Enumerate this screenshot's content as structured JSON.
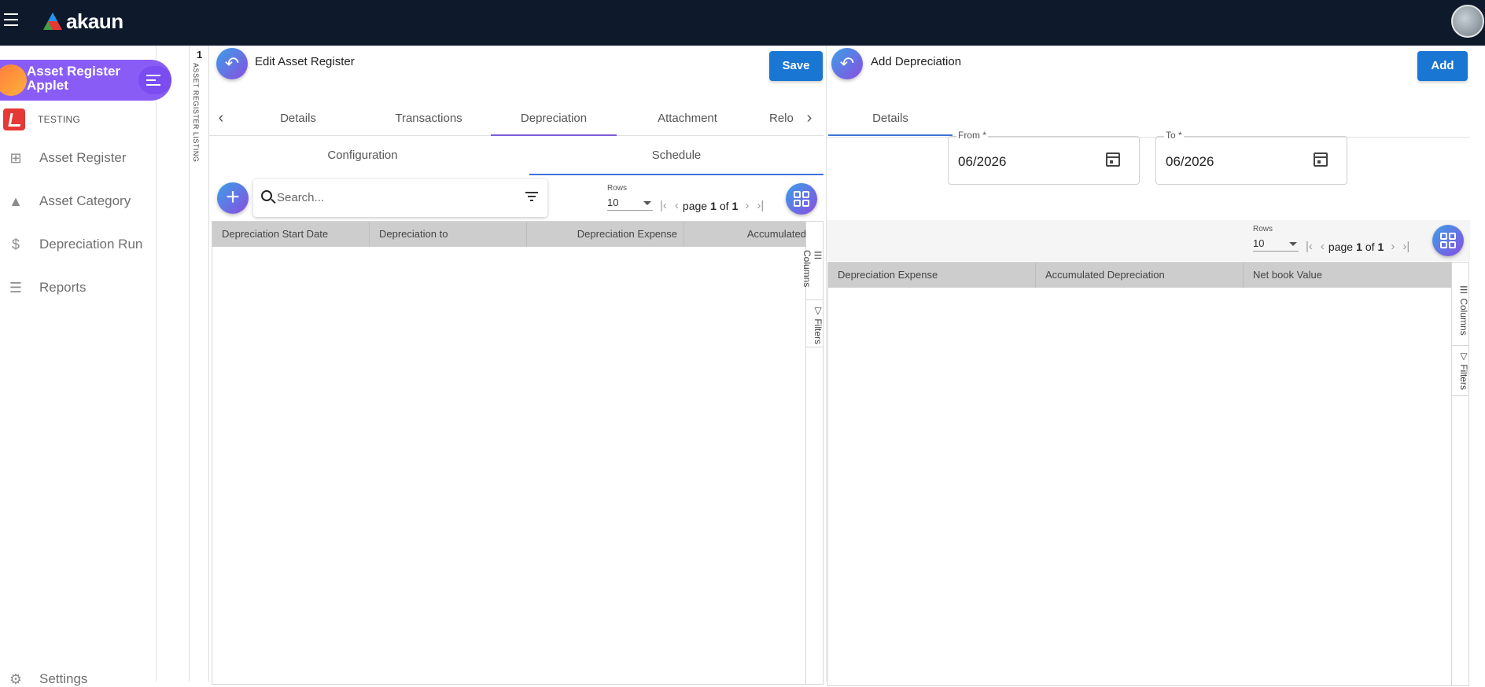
{
  "topbar": {
    "brand": "akaun"
  },
  "sidebar": {
    "applet_title": "Asset Register Applet",
    "org_label": "TESTING",
    "items": [
      {
        "label": "Asset Register",
        "icon": "chart-add-icon"
      },
      {
        "label": "Asset Category",
        "icon": "shapes-icon"
      },
      {
        "label": "Depreciation Run",
        "icon": "dollar-icon"
      },
      {
        "label": "Reports",
        "icon": "list-icon"
      },
      {
        "label": "Settings",
        "icon": "gear-icon"
      }
    ]
  },
  "listing": {
    "count": "1",
    "label": "ASSET REGISTER LISTING"
  },
  "edit_panel": {
    "title": "Edit Asset Register",
    "save_label": "Save",
    "tabs": [
      "Details",
      "Transactions",
      "Depreciation",
      "Attachment",
      "Relo"
    ],
    "subtabs": [
      "Configuration",
      "Schedule"
    ],
    "search_placeholder": "Search...",
    "rows_label": "Rows",
    "rows_value": "10",
    "pager": {
      "page_word": "page",
      "page": "1",
      "of_word": "of",
      "total": "1"
    },
    "columns": [
      "Depreciation Start Date",
      "Depreciation to",
      "Depreciation Expense",
      "Accumulated"
    ],
    "side_tools": [
      "Columns",
      "Filters"
    ]
  },
  "add_panel": {
    "title": "Add Depreciation",
    "add_label": "Add",
    "tab": "Details",
    "from_label": "From *",
    "from_value": "06/2026",
    "to_label": "To *",
    "to_value": "06/2026",
    "rows_label": "Rows",
    "rows_value": "10",
    "pager": {
      "page_word": "page",
      "page": "1",
      "of_word": "of",
      "total": "1"
    },
    "columns": [
      "Depreciation Expense",
      "Accumulated Depreciation",
      "Net book Value"
    ],
    "side_tools": [
      "Columns",
      "Filters"
    ]
  },
  "colors": {
    "topbar": "#0e1a2b",
    "applet_pill": "#8a5cf6",
    "primary": "#1976d2",
    "header_row": "#cdcdcd"
  }
}
